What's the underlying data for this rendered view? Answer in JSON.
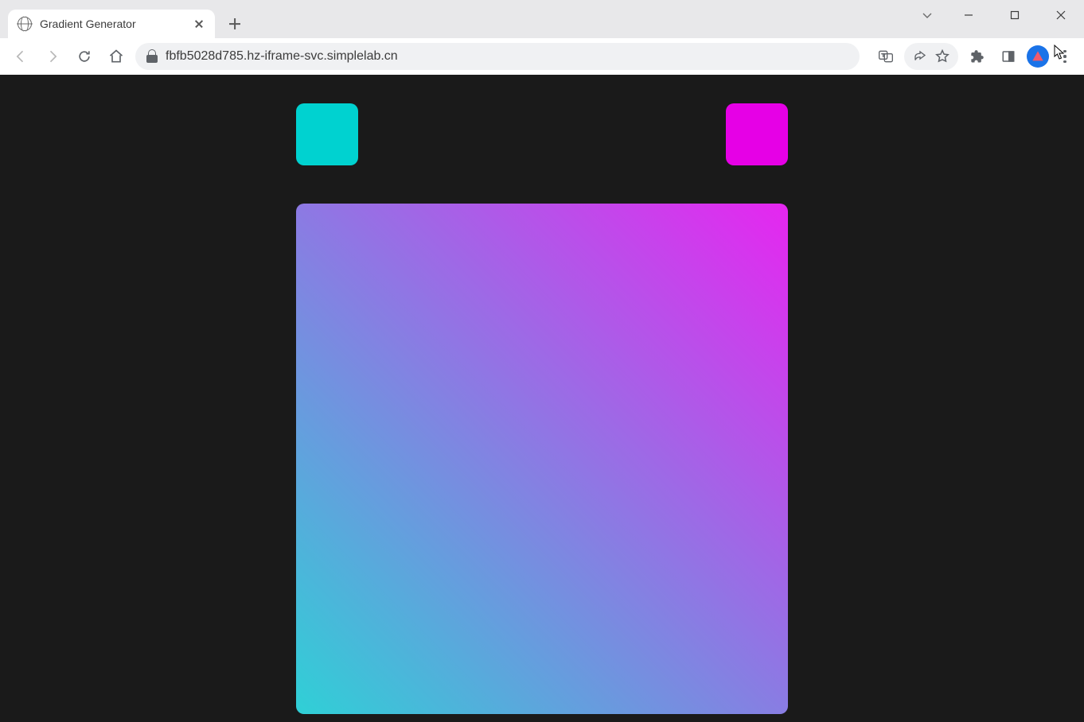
{
  "browser": {
    "tab_title": "Gradient Generator",
    "url": "fbfb5028d785.hz-iframe-svc.simplelab.cn",
    "icons": {
      "globe": "globe-icon",
      "close": "close-icon",
      "new_tab": "plus-icon",
      "back": "back-icon",
      "forward": "forward-icon",
      "reload": "reload-icon",
      "home": "home-icon",
      "lock": "lock-icon",
      "translate": "translate-icon",
      "share": "share-icon",
      "star": "star-icon",
      "extensions": "puzzle-icon",
      "side_panel": "side-panel-icon",
      "profile": "profile-avatar",
      "menu": "kebab-icon",
      "win_chevron": "chevron-down-icon",
      "win_min": "minimize-icon",
      "win_max": "maximize-icon",
      "win_close": "window-close-icon"
    }
  },
  "app": {
    "color_start": "#00d2d0",
    "color_end": "#e600e6",
    "gradient_start": "#2fd0d6",
    "gradient_end": "#e626f0",
    "gradient_angle_deg": 45,
    "background": "#1a1a1a"
  }
}
